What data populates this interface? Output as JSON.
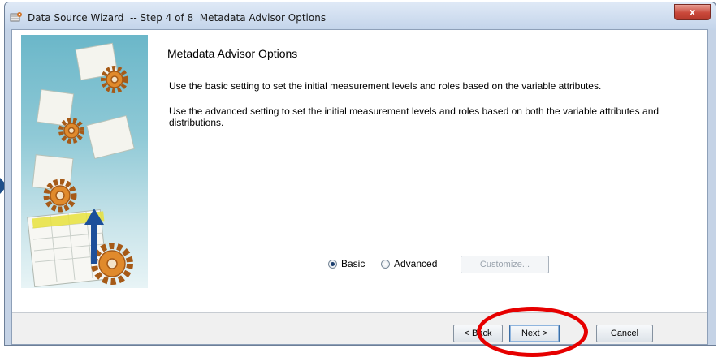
{
  "window": {
    "title": "Data Source Wizard  -- Step 4 of 8  Metadata Advisor Options",
    "close_label": "x"
  },
  "content": {
    "heading": "Metadata Advisor Options",
    "paragraph_basic": "Use the basic setting to set the initial measurement levels and roles based on the variable attributes.",
    "paragraph_advanced": "Use the advanced setting to set the initial measurement levels and roles based on both the variable attributes and distributions."
  },
  "options": {
    "selected": "Basic",
    "basic_label": "Basic",
    "advanced_label": "Advanced",
    "customize_label": "Customize..."
  },
  "buttons": {
    "back_label": "< Back",
    "next_label": "Next >",
    "cancel_label": "Cancel"
  },
  "annotation": {
    "highlight_color": "#e60000",
    "pointer_color": "#1f4f8a"
  },
  "icons": [
    "app-wizard-icon",
    "close-icon",
    "gear-icon",
    "data-table-icon",
    "upload-arrow-icon"
  ]
}
